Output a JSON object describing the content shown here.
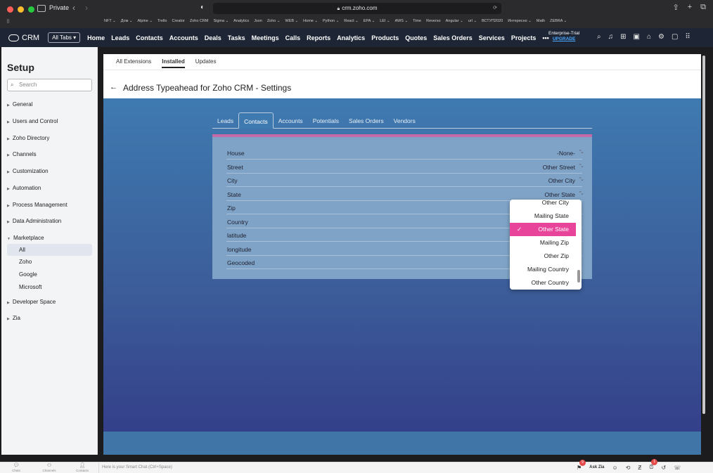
{
  "browser": {
    "private_label": "Private",
    "url": "crm.zoho.com",
    "bookmarks": [
      "NFT ⌄",
      "Дом ⌄",
      "Alpine ⌄",
      "Trello",
      "Creator",
      "Zoho CRM",
      "Sigma ⌄",
      "Analytics",
      "Json",
      "Zoho ⌄",
      "WEB ⌄",
      "Home ⌄",
      "Python ⌄",
      "React ⌄",
      "EPA ⌄",
      "LEI ⌄",
      "AWS ⌄",
      "Time",
      "Reverso",
      "Angular ⌄",
      "url ⌄",
      "ВСТУП2020",
      "Интересно ⌄",
      "Math",
      "ZEBRA ⌄"
    ]
  },
  "crm": {
    "logo": "CRM",
    "all_tabs": "All Tabs ▾",
    "menu": [
      "Home",
      "Leads",
      "Contacts",
      "Accounts",
      "Deals",
      "Tasks",
      "Meetings",
      "Calls",
      "Reports",
      "Analytics",
      "Products",
      "Quotes",
      "Sales Orders",
      "Services",
      "Projects",
      "•••"
    ],
    "trial": {
      "line1": "Enterprise-Trial",
      "upgrade": "UPGRADE"
    }
  },
  "setup": {
    "title": "Setup",
    "search_placeholder": "Search",
    "items": [
      "General",
      "Users and Control",
      "Zoho Directory",
      "Channels",
      "Customization",
      "Automation",
      "Process Management",
      "Data Administration",
      "Marketplace"
    ],
    "marketplace_sub": [
      "All",
      "Zoho",
      "Google",
      "Microsoft"
    ],
    "items_after": [
      "Developer Space",
      "Zia"
    ]
  },
  "main": {
    "subtabs": [
      "All Extensions",
      "Installed",
      "Updates"
    ],
    "page_title": "Address Typeahead for Zoho CRM - Settings",
    "object_tabs": [
      "Leads",
      "Contacts",
      "Accounts",
      "Potentials",
      "Sales Orders",
      "Vendors"
    ],
    "fields": [
      {
        "label": "House",
        "value": "-None-"
      },
      {
        "label": "Street",
        "value": "Other Street"
      },
      {
        "label": "City",
        "value": "Other City"
      },
      {
        "label": "State",
        "value": "Other State"
      },
      {
        "label": "Zip",
        "value": ""
      },
      {
        "label": "Country",
        "value": ""
      },
      {
        "label": "latitude",
        "value": ""
      },
      {
        "label": "longitude",
        "value": ""
      },
      {
        "label": "Geocoded",
        "value": ""
      }
    ],
    "dropdown_options": [
      "Other City",
      "Mailing State",
      "Other State",
      "Mailing Zip",
      "Other Zip",
      "Mailing Country",
      "Other Country"
    ],
    "dropdown_selected": "Other State"
  },
  "bottombar": {
    "items": [
      "Chats",
      "Channels",
      "Contacts"
    ],
    "smartchat_placeholder": "Here is your Smart Chat (Ctrl+Space)",
    "ask_zia": "Ask Zia",
    "notification_badge_left": "9",
    "notification_badge_right": "1"
  },
  "colors": {
    "nav_bg": "#1e2534",
    "accent_pink": "#e8459a",
    "app_blue": "#3e7ab0",
    "upgrade_blue": "#4aa8ff"
  }
}
